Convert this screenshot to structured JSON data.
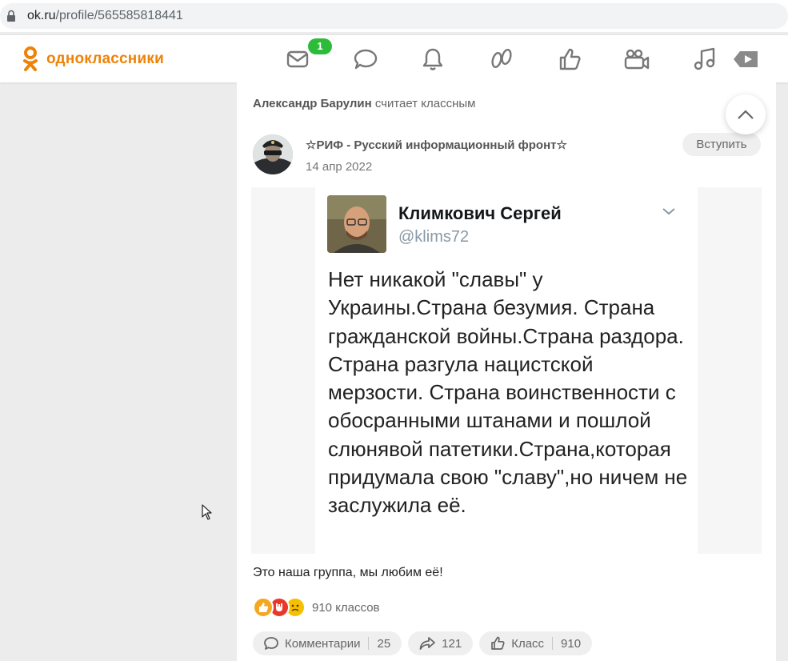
{
  "browser": {
    "url_host": "ok.ru",
    "url_path": "/profile/565585818441"
  },
  "header": {
    "logo_text": "одноклассники",
    "messages_badge": "1",
    "nav_icons": [
      "messages-icon",
      "discussions-icon",
      "notifications-icon",
      "guests-icon",
      "marks-icon",
      "video-icon",
      "music-icon",
      "video-player-icon"
    ]
  },
  "feed": {
    "liker_name": "Александр Барулин",
    "liker_action": "считает классным",
    "group_name": "☆РИФ - Русский информационный фронт☆",
    "date": "14 апр 2022",
    "join_label": "Вступить",
    "caption": "Это наша группа, мы любим её!",
    "reactions_count": "910 классов",
    "reactions": [
      "like-icon",
      "super-icon",
      "sad-icon"
    ]
  },
  "tweet": {
    "name": "Климкович Сергей",
    "handle": "@klims72",
    "text": "Нет никакой \"славы\" у Украины.Страна безумия. Страна гражданской войны.Страна раздора. Страна разгула нацистской мерзости. Страна воинственности с обосранными штанами и пошлой слюнявой патетики.Страна,которая придумала свою \"славу\",но ничем не заслужила её."
  },
  "actions": {
    "comments_label": "Комментарии",
    "comments_count": "25",
    "shares_count": "121",
    "class_label": "Класс",
    "class_count": "910"
  },
  "colors": {
    "brand": "#ee8208",
    "badge": "#2dbb3a"
  }
}
